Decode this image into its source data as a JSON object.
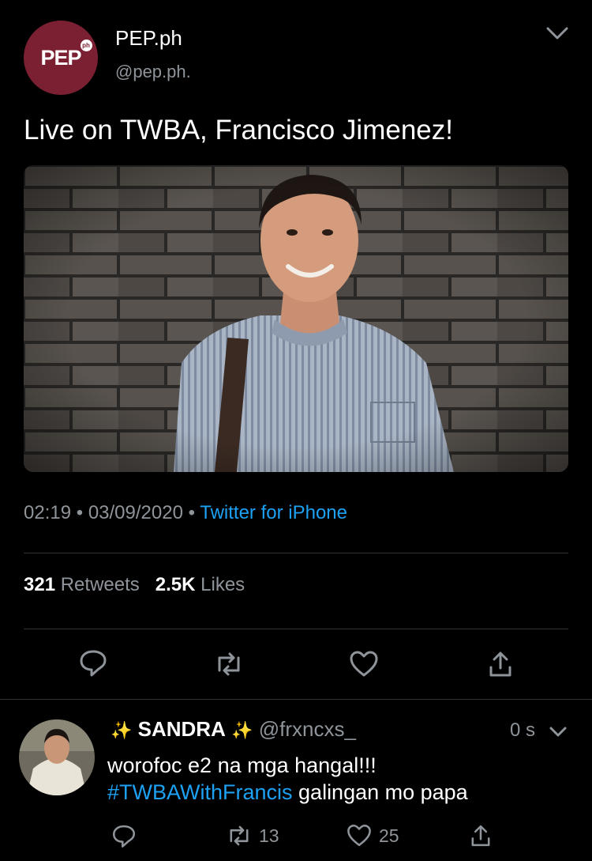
{
  "tweet": {
    "author_name": "PEP.ph",
    "author_handle": "@pep.ph.",
    "avatar_text": "PEP",
    "avatar_badge": "ph",
    "text": "Live on TWBA, Francisco Jimenez!",
    "time": "02:19",
    "date": "03/09/2020",
    "separator": "•",
    "source": "Twitter for iPhone",
    "retweets_count": "321",
    "retweets_label": "Retweets",
    "likes_count": "2.5K",
    "likes_label": "Likes"
  },
  "reply": {
    "sparkle_left": "✨",
    "name": "SANDRA",
    "sparkle_right": "✨",
    "handle": "@frxncxs_",
    "time": "0 s",
    "text_line1": "worofoc e2 na mga hangal!!!",
    "hashtag": "#TWBAWithFrancis",
    "text_line2_rest": " galingan mo papa",
    "retweets": "13",
    "likes": "25"
  },
  "colors": {
    "background": "#000000",
    "link": "#1da1f2",
    "secondary_text": "#8e9499",
    "pep_brand": "#7b2033"
  },
  "icons": [
    "chevron-down-icon",
    "reply-icon",
    "retweet-icon",
    "like-icon",
    "share-icon"
  ]
}
